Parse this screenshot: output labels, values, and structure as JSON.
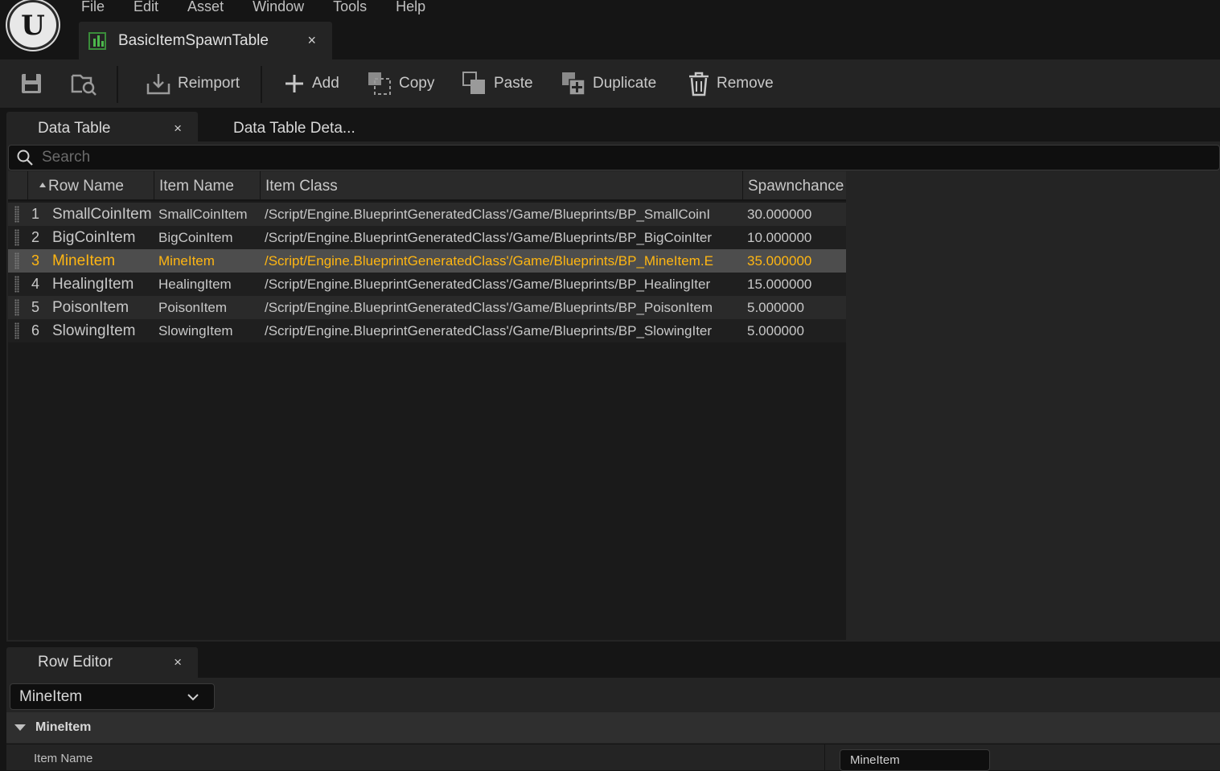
{
  "menu": [
    "File",
    "Edit",
    "Asset",
    "Window",
    "Tools",
    "Help"
  ],
  "document_tab": {
    "label": "BasicItemSpawnTable",
    "close": "×"
  },
  "toolbar": {
    "reimport": "Reimport",
    "add": "Add",
    "copy": "Copy",
    "paste": "Paste",
    "duplicate": "Duplicate",
    "remove": "Remove"
  },
  "panel_tabs": {
    "data_table": "Data Table",
    "data_table_details": "Data Table Deta...",
    "row_editor": "Row Editor",
    "close": "×"
  },
  "search": {
    "placeholder": "Search"
  },
  "table": {
    "columns": [
      "Row Name",
      "Item Name",
      "Item Class",
      "Spawnchance"
    ],
    "rows": [
      {
        "num": "1",
        "row_name": "SmallCoinItem",
        "item_name": "SmallCoinItem",
        "item_class": "/Script/Engine.BlueprintGeneratedClass'/Game/Blueprints/BP_SmallCoinI",
        "spawn": "30.000000"
      },
      {
        "num": "2",
        "row_name": "BigCoinItem",
        "item_name": "BigCoinItem",
        "item_class": "/Script/Engine.BlueprintGeneratedClass'/Game/Blueprints/BP_BigCoinIter",
        "spawn": "10.000000"
      },
      {
        "num": "3",
        "row_name": "MineItem",
        "item_name": "MineItem",
        "item_class": "/Script/Engine.BlueprintGeneratedClass'/Game/Blueprints/BP_MineItem.E",
        "spawn": "35.000000"
      },
      {
        "num": "4",
        "row_name": "HealingItem",
        "item_name": "HealingItem",
        "item_class": "/Script/Engine.BlueprintGeneratedClass'/Game/Blueprints/BP_HealingIter",
        "spawn": "15.000000"
      },
      {
        "num": "5",
        "row_name": "PoisonItem",
        "item_name": "PoisonItem",
        "item_class": "/Script/Engine.BlueprintGeneratedClass'/Game/Blueprints/BP_PoisonItem",
        "spawn": "5.000000"
      },
      {
        "num": "6",
        "row_name": "SlowingItem",
        "item_name": "SlowingItem",
        "item_class": "/Script/Engine.BlueprintGeneratedClass'/Game/Blueprints/BP_SlowingIter",
        "spawn": "5.000000"
      }
    ],
    "selected_row": "3"
  },
  "row_editor": {
    "selected": "MineItem",
    "section": "MineItem",
    "property_label": "Item Name",
    "property_value": "MineItem"
  },
  "colors": {
    "selection": "#ffb612",
    "background": "#151515",
    "panel": "#242424"
  }
}
